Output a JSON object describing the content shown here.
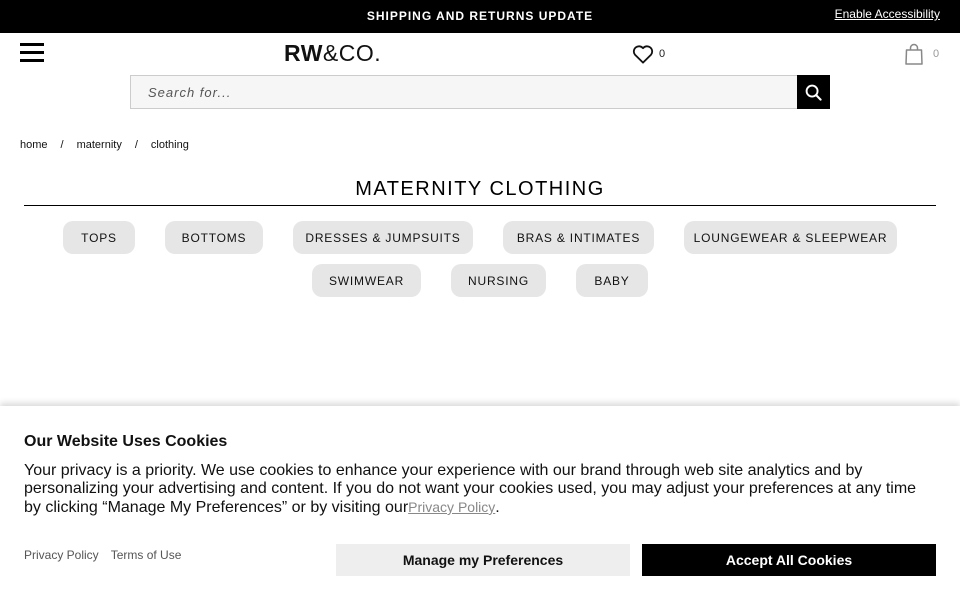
{
  "topbar": {
    "message": "SHIPPING AND RETURNS UPDATE",
    "accessibility_link": "Enable Accessibility"
  },
  "header": {
    "menu_icon": "hamburger-menu-icon",
    "logo_bold": "RW",
    "logo_rest": "&CO.",
    "wishlist_icon": "heart-icon",
    "wishlist_count": "0",
    "bag_icon": "shopping-bag-icon",
    "bag_count": "0"
  },
  "search": {
    "placeholder": "Search for...",
    "value": "",
    "button_icon": "search-icon"
  },
  "breadcrumb": {
    "items": [
      "home",
      "maternity",
      "clothing"
    ],
    "separator": "/"
  },
  "page": {
    "title": "MATERNITY CLOTHING"
  },
  "categories": [
    "TOPS",
    "BOTTOMS",
    "DRESSES & JUMPSUITS",
    "BRAS & INTIMATES",
    "LOUNGEWEAR & SLEEPWEAR",
    "SWIMWEAR",
    "NURSING",
    "BABY"
  ],
  "cookie_banner": {
    "title": "Our Website Uses Cookies",
    "body": "Your privacy is a priority. We use cookies to enhance your experience with our brand through web site analytics and by personalizing your advertising and content. If you do not want your cookies used, you may adjust your preferences at any time by clicking “Manage My Preferences” or by visiting our",
    "privacy_link_inline": "Privacy Policy",
    "body_end": ".",
    "footer_links": [
      "Privacy Policy",
      "Terms of Use"
    ],
    "manage_button": "Manage my Preferences",
    "accept_button": "Accept All Cookies"
  },
  "colors": {
    "topbar_bg": "#000000",
    "pill_bg": "#e6e6e6",
    "accept_bg": "#000000",
    "manage_bg": "#eeeeee"
  }
}
